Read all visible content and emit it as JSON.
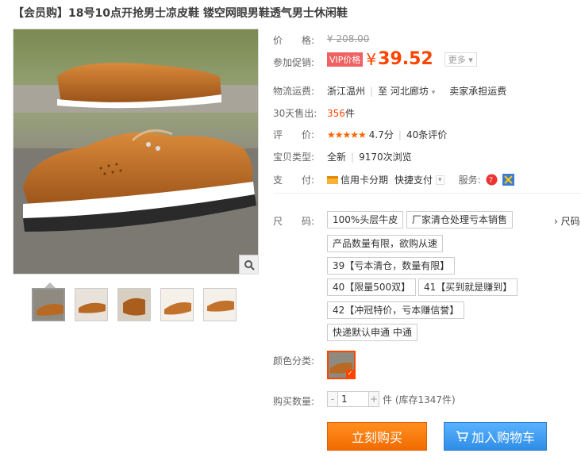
{
  "title": "【会员购】18号10点开抢男士凉皮鞋 镂空网眼男鞋透气男士休闲鞋",
  "price": {
    "label": "价　　格:",
    "original": "¥ 208.00"
  },
  "promo": {
    "label": "参加促销:",
    "badge": "VIP价格",
    "currency": "¥",
    "value": "39.52",
    "more": "更多"
  },
  "shipping": {
    "label": "物流运费:",
    "from": "浙江温州",
    "to": "至  河北廊坊",
    "note": "卖家承担运费"
  },
  "sold": {
    "label": "30天售出:",
    "count": "356",
    "unit": "件"
  },
  "rating": {
    "label": "评　　价:",
    "stars": "★★★★★",
    "score": "4.7分",
    "reviews": "40条评价"
  },
  "item_type": {
    "label": "宝贝类型:",
    "condition": "全新",
    "views": "9170次浏览"
  },
  "payment": {
    "label": "支　　付:",
    "installment": "信用卡分期",
    "quick": "快捷支付",
    "service_label": "服务:"
  },
  "sizes": {
    "label": "尺　　码:",
    "more": "尺码",
    "options": [
      "100%头层牛皮",
      "厂家清仓处理亏本销售",
      "产品数量有限，欲购从速",
      "39【亏本清仓，数量有限】",
      "40【限量500双】",
      "41【买到就是赚到】",
      "42【冲冠特价，亏本赚信誉】",
      "快递默认申通 中通"
    ]
  },
  "color": {
    "label": "颜色分类:"
  },
  "quantity": {
    "label": "购买数量:",
    "value": "1",
    "stock": "件 (库存1347件)"
  },
  "buttons": {
    "buy": "立刻购买",
    "cart": "加入购物车"
  },
  "colors": {
    "accent": "#ff4400",
    "buy": "#f26b00",
    "cart": "#2e8de6"
  }
}
